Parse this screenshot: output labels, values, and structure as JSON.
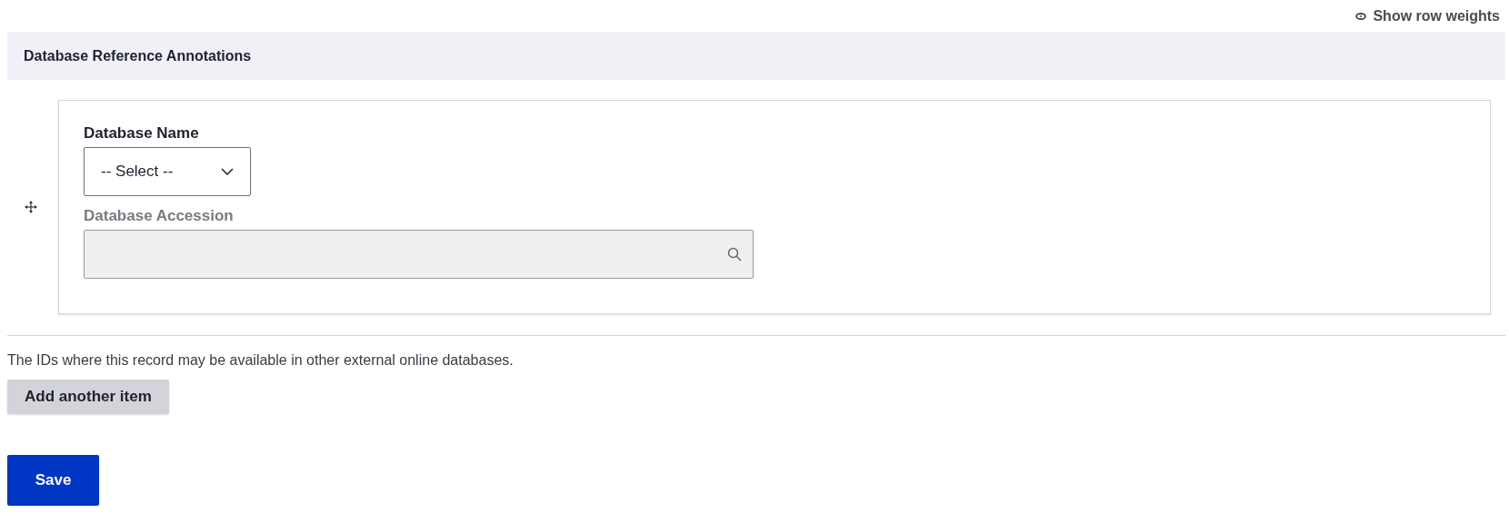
{
  "toggle_link": {
    "label": "Show row weights"
  },
  "section": {
    "title": "Database Reference Annotations"
  },
  "items": [
    {
      "fields": [
        {
          "kind": "select",
          "label": "Database Name",
          "value": "-- Select --",
          "disabled": false
        },
        {
          "kind": "autocomplete",
          "label": "Database Accession",
          "disabled": true
        }
      ]
    }
  ],
  "description": "The IDs where this record may be available in other external online databases.",
  "add_button": "Add another item",
  "save_button": "Save"
}
